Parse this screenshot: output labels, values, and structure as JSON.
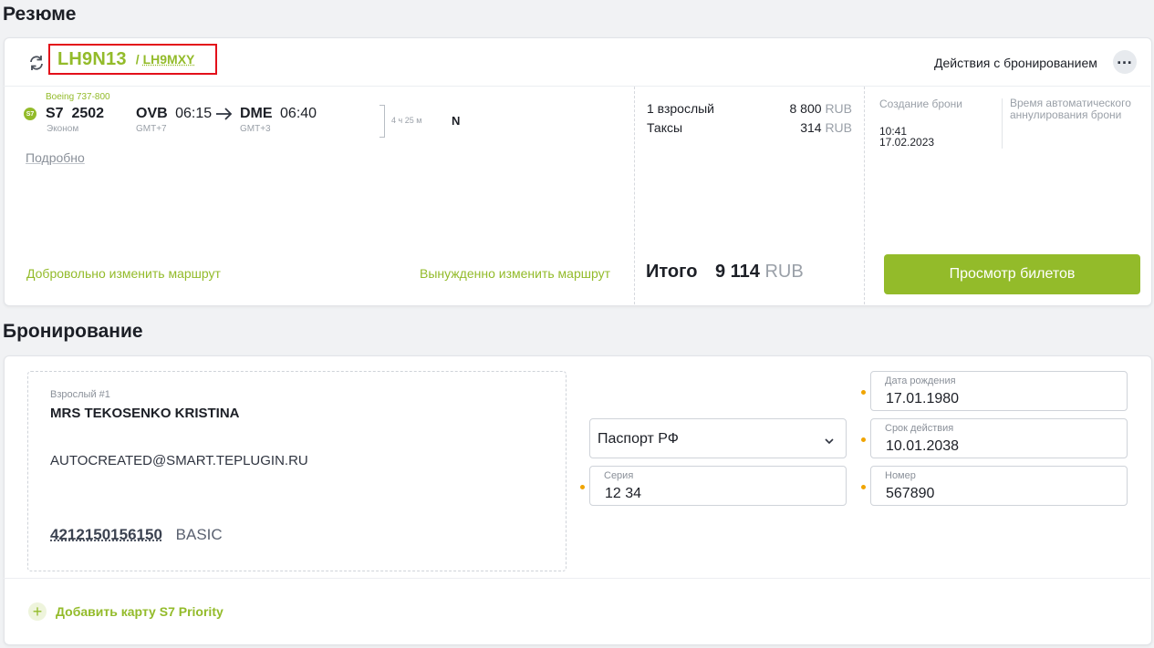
{
  "summary": {
    "title": "Резюме",
    "pnr_main": "LH9N13",
    "pnr_separator": "/",
    "pnr_secondary": "LH9MXY",
    "actions_label": "Действия с бронированием",
    "flight": {
      "aircraft": "Boeing 737-800",
      "carrier": "S7",
      "flight_number": "2502",
      "cabin": "Эконом",
      "origin": "OVB",
      "departure_time": "06:15",
      "origin_tz": "GMT+7",
      "destination": "DME",
      "arrival_time": "06:40",
      "destination_tz": "GMT+3",
      "duration": "4 ч 25 м",
      "fare_class": "N",
      "details_link": "Подробно"
    },
    "voluntary_change": "Добровольно изменить маршрут",
    "forced_change": "Вынужденно изменить маршрут",
    "price": {
      "adult_label": "1 взрослый",
      "adult_amount": "8 800",
      "taxes_label": "Таксы",
      "taxes_amount": "314",
      "currency": "RUB",
      "total_label": "Итого",
      "total_amount": "9 114"
    },
    "created_label": "Создание брони",
    "created_time": "10:41",
    "created_date": "17.02.2023",
    "auto_cancel_label": "Время автоматического аннулирования брони",
    "view_tickets": "Просмотр билетов"
  },
  "booking": {
    "title": "Бронирование",
    "passenger": {
      "type_label": "Взрослый #1",
      "name": "MRS TEKOSENKO KRISTINA",
      "email": "AUTOCREATED@SMART.TEPLUGIN.RU",
      "loyalty_number": "4212150156150",
      "loyalty_tier": "BASIC"
    },
    "document_type": "Паспорт РФ",
    "birth_date_label": "Дата рождения",
    "birth_date": "17.01.1980",
    "expiry_label": "Срок действия",
    "expiry_date": "10.01.2038",
    "series_label": "Серия",
    "series": "12 34",
    "number_label": "Номер",
    "number": "567890",
    "add_card": "Добавить карту S7 Priority"
  },
  "colors": {
    "accent": "#93bb2a",
    "highlight_border": "#e3101a",
    "required_dot": "#f0a400"
  }
}
